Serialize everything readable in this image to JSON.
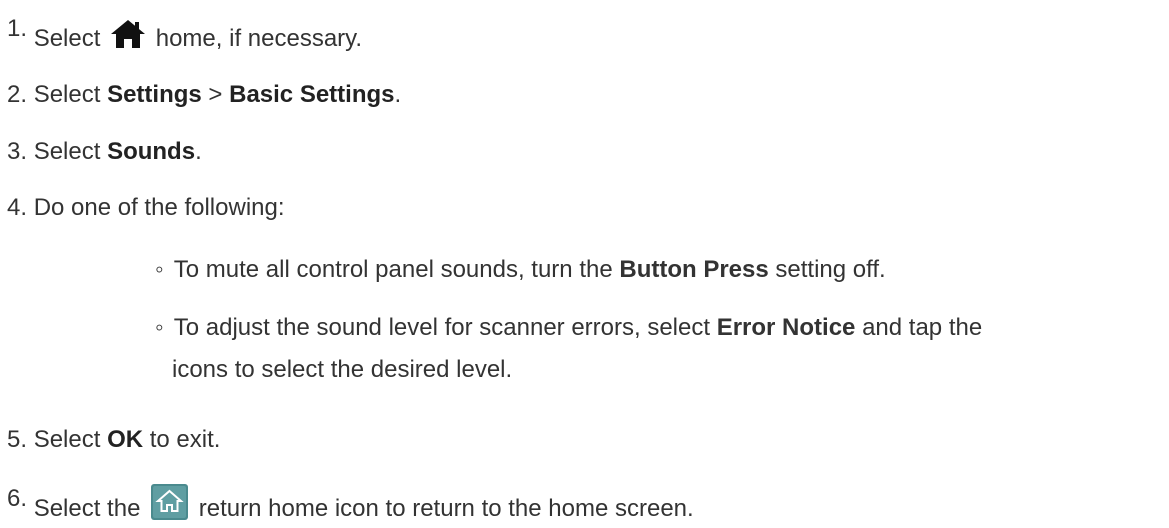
{
  "steps": [
    {
      "number": "1.",
      "text_before": "Select",
      "icon": "home-icon",
      "text_after": "home, if necessary."
    },
    {
      "number": "2.",
      "text_before": "Select",
      "bold1": "Settings",
      "mid": ">",
      "bold2": "Basic Settings",
      "end": "."
    },
    {
      "number": "3.",
      "text_before": "Select",
      "bold1": "Sounds",
      "end": "."
    },
    {
      "number": "4.",
      "text": "Do one of the following:",
      "sub_items": [
        {
          "bullet": "◦",
          "text_before": "To mute all control panel sounds, turn the",
          "bold": "Button Press",
          "text_after": "setting off."
        },
        {
          "bullet": "◦",
          "text_before": "To adjust the sound level for scanner errors, select",
          "bold": "Error Notice",
          "text_after": "and tap the",
          "line2": "icons to select the desired level."
        }
      ]
    },
    {
      "number": "5.",
      "text_before": "Select",
      "bold1": "OK",
      "end": "to exit."
    },
    {
      "number": "6.",
      "text_before": "Select the",
      "icon": "return-home-icon",
      "text_after": "return home icon to return to the home screen."
    }
  ],
  "colors": {
    "text": "#333333",
    "bold": "#222222",
    "return_icon_bg": "#4a8a8e"
  }
}
